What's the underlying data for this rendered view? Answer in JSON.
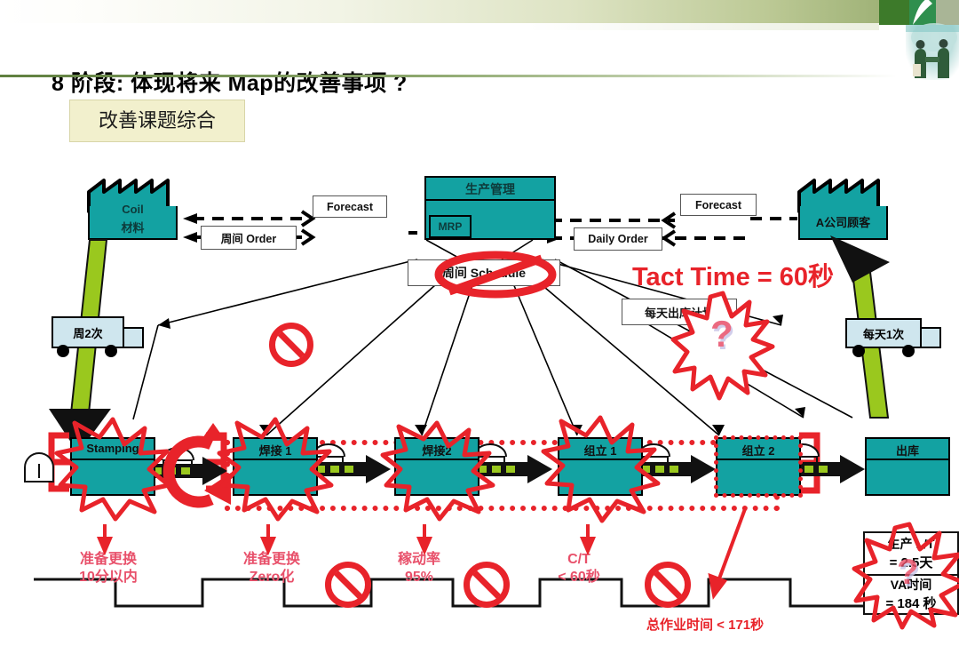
{
  "header": {
    "title": "8 阶段: 体现将来 Map的改善事项 ?",
    "logo_icon": "handshake-photo",
    "accent_green": "#3d7a2a",
    "band_green": "#86a25e"
  },
  "subtitle": {
    "label": "改善课题综合"
  },
  "diagram": {
    "supplier": {
      "name_line1": "Coil",
      "name_line2": "材料",
      "icon": "factory-icon"
    },
    "customer": {
      "name": "A公司顾客",
      "icon": "factory-icon"
    },
    "control": {
      "title": "生产管理",
      "mrp": "MRP"
    },
    "info_flows": [
      {
        "id": "forecast-left",
        "label": "Forecast"
      },
      {
        "id": "weekly-order",
        "label": "周间 Order"
      },
      {
        "id": "forecast-right",
        "label": "Forecast"
      },
      {
        "id": "daily-order",
        "label": "Daily Order"
      },
      {
        "id": "weekly-schedule",
        "label": "周间 Schedule",
        "crossed_out": true
      },
      {
        "id": "daily-ship-plan",
        "label": "每天出库计划",
        "burst": true,
        "burst_mark": "?"
      }
    ],
    "tact": {
      "label": "Tact Time  =  60秒",
      "color": "#e8232a"
    },
    "trucks": [
      {
        "id": "inbound-truck",
        "label": "周2次"
      },
      {
        "id": "outbound-truck",
        "label": "每天1次"
      }
    ],
    "processes": [
      {
        "id": "stamping",
        "label": "Stamping",
        "burst": true
      },
      {
        "id": "welding-1",
        "label": "焊接 1",
        "burst": true
      },
      {
        "id": "welding-2",
        "label": "焊接2",
        "burst": true
      },
      {
        "id": "assembly-1",
        "label": "组立 1",
        "burst": true
      },
      {
        "id": "assembly-2",
        "label": "组立 2",
        "burst": false
      },
      {
        "id": "shipping",
        "label": "出库",
        "burst": false
      }
    ],
    "timeline_notes": [
      {
        "id": "note-changeover-10",
        "line1": "准备更换",
        "line2": "10分以内"
      },
      {
        "id": "note-changeover-zero",
        "line1": "准备更换",
        "line2": "Zero化"
      },
      {
        "id": "note-uptime",
        "line1": "稼动率",
        "line2": "95%"
      },
      {
        "id": "note-cycle-time",
        "line1": "C/T",
        "line2": "< 60秒"
      }
    ],
    "summary_box": {
      "line1": "生产 L/T",
      "line2": "= 2.5天",
      "line3": "VA时间",
      "line4": "= 184 秒",
      "burst_mark": "?"
    },
    "total_work_note": "总作业时间 < 171秒",
    "colors": {
      "teal": "#13a2a2",
      "red": "#e8232a",
      "pink": "#e8506a",
      "green_arrow": "#9ac81e",
      "subtitle_bg": "#f2f0cd"
    }
  }
}
